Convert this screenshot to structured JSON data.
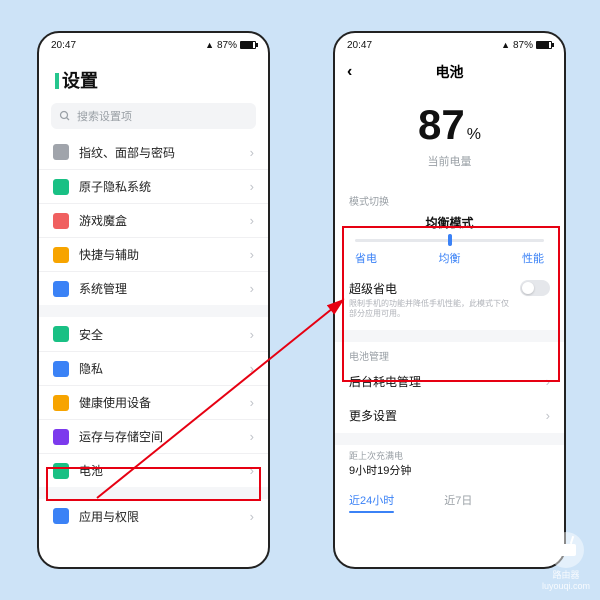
{
  "status": {
    "time": "20:47",
    "pct": "87%"
  },
  "left": {
    "title": "设置",
    "search_placeholder": "搜索设置项",
    "items_a": [
      {
        "label": "指纹、面部与密码",
        "color": "#a0a4ab"
      },
      {
        "label": "原子隐私系统",
        "color": "#19c084"
      },
      {
        "label": "游戏魔盒",
        "color": "#f06060"
      },
      {
        "label": "快捷与辅助",
        "color": "#f7a400"
      },
      {
        "label": "系统管理",
        "color": "#3b82f6"
      }
    ],
    "items_b": [
      {
        "label": "安全",
        "color": "#19c084"
      },
      {
        "label": "隐私",
        "color": "#3b82f6"
      },
      {
        "label": "健康使用设备",
        "color": "#f7a400"
      },
      {
        "label": "运存与存储空间",
        "color": "#7c3aed"
      },
      {
        "label": "电池",
        "color": "#19c084"
      }
    ],
    "items_c": [
      {
        "label": "应用与权限",
        "color": "#3b82f6"
      }
    ]
  },
  "right": {
    "title": "电池",
    "pct": "87",
    "pct_unit": "%",
    "pct_label": "当前电量",
    "mode_section": "模式切换",
    "mode_title": "均衡模式",
    "mode_options": [
      "省电",
      "均衡",
      "性能"
    ],
    "super_save": "超级省电",
    "super_desc": "限制手机的功能并降低手机性能，此模式下仅部分应用可用。",
    "mgmt_section": "电池管理",
    "rows": [
      "后台耗电管理",
      "更多设置"
    ],
    "last_charge_label": "距上次充满电",
    "last_charge_value": "9小时19分钟",
    "tabs": [
      "近24小时",
      "近7日"
    ]
  },
  "watermark": {
    "top": "路由器",
    "bottom": "luyouqi.com"
  }
}
